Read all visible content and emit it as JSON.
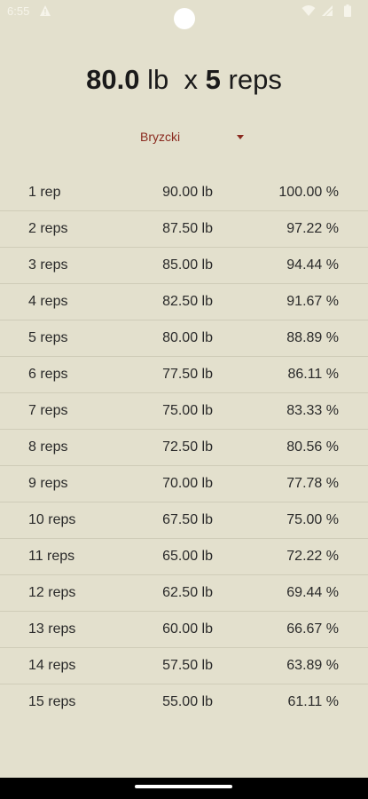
{
  "status_bar": {
    "time": "6:55"
  },
  "header": {
    "weight_value": "80.0",
    "weight_unit": "lb",
    "times": "x",
    "reps_value": "5",
    "reps_unit": "reps"
  },
  "formula_dropdown": {
    "selected": "Bryzcki"
  },
  "table": {
    "rows": [
      {
        "reps": "1 rep",
        "weight": "90.00 lb",
        "percent": "100.00 %"
      },
      {
        "reps": "2 reps",
        "weight": "87.50 lb",
        "percent": "97.22 %"
      },
      {
        "reps": "3 reps",
        "weight": "85.00 lb",
        "percent": "94.44 %"
      },
      {
        "reps": "4 reps",
        "weight": "82.50 lb",
        "percent": "91.67 %"
      },
      {
        "reps": "5 reps",
        "weight": "80.00 lb",
        "percent": "88.89 %"
      },
      {
        "reps": "6 reps",
        "weight": "77.50 lb",
        "percent": "86.11 %"
      },
      {
        "reps": "7 reps",
        "weight": "75.00 lb",
        "percent": "83.33 %"
      },
      {
        "reps": "8 reps",
        "weight": "72.50 lb",
        "percent": "80.56 %"
      },
      {
        "reps": "9 reps",
        "weight": "70.00 lb",
        "percent": "77.78 %"
      },
      {
        "reps": "10 reps",
        "weight": "67.50 lb",
        "percent": "75.00 %"
      },
      {
        "reps": "11 reps",
        "weight": "65.00 lb",
        "percent": "72.22 %"
      },
      {
        "reps": "12 reps",
        "weight": "62.50 lb",
        "percent": "69.44 %"
      },
      {
        "reps": "13 reps",
        "weight": "60.00 lb",
        "percent": "66.67 %"
      },
      {
        "reps": "14 reps",
        "weight": "57.50 lb",
        "percent": "63.89 %"
      },
      {
        "reps": "15 reps",
        "weight": "55.00 lb",
        "percent": "61.11 %"
      }
    ]
  },
  "icons": {
    "warning": "warning-icon",
    "wifi": "wifi-icon",
    "battery": "battery-icon"
  },
  "colors": {
    "background": "#e3e0cd",
    "accent": "#8a2a1f",
    "divider": "#cfccb8"
  }
}
